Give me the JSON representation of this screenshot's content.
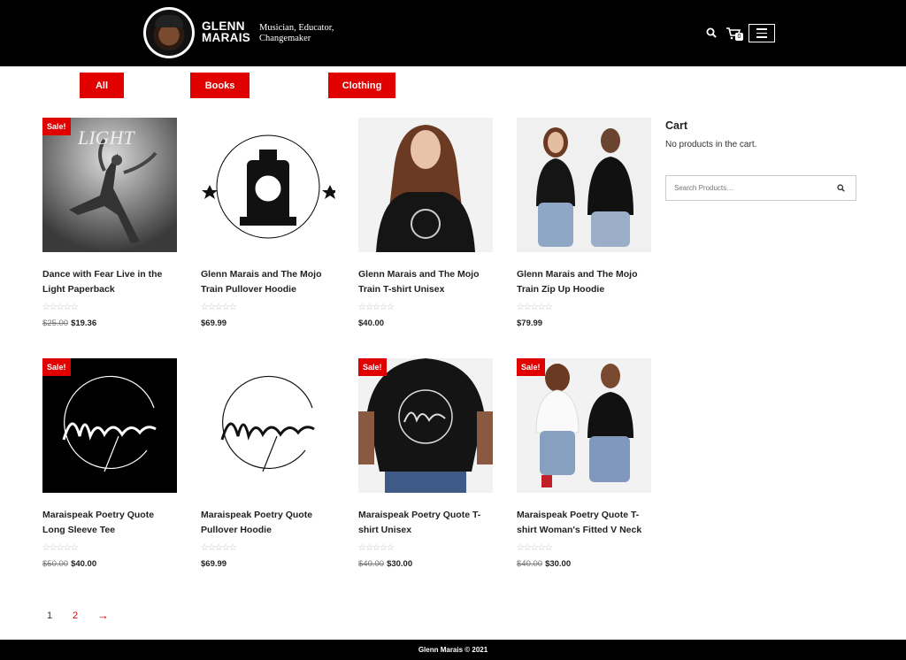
{
  "header": {
    "brand_line1": "GLENN",
    "brand_line2": "MARAIS",
    "tagline_line1": "Musician, Educator,",
    "tagline_line2": "Changemaker",
    "cart_count": "0"
  },
  "filters": [
    "All",
    "Books",
    "Clothing"
  ],
  "products": [
    {
      "title": "Dance with Fear Live in the Light Paperback",
      "sale": "Sale!",
      "old_price": "$25.00",
      "price": "$19.36",
      "image": "book-cover-dancer"
    },
    {
      "title": "Glenn Marais and The Mojo Train Pullover Hoodie",
      "sale": "",
      "old_price": "",
      "price": "$69.99",
      "image": "mojo-train-logo"
    },
    {
      "title": "Glenn Marais and The Mojo Train T-shirt Unisex",
      "sale": "",
      "old_price": "",
      "price": "$40.00",
      "image": "woman-black-tshirt"
    },
    {
      "title": "Glenn Marais and The Mojo Train Zip Up Hoodie",
      "sale": "",
      "old_price": "",
      "price": "$79.99",
      "image": "couple-black-apparel"
    },
    {
      "title": "Maraispeak Poetry Quote Long Sleeve Tee",
      "sale": "Sale!",
      "old_price": "$50.00",
      "price": "$40.00",
      "image": "maraispeak-white-on-black"
    },
    {
      "title": "Maraispeak Poetry Quote Pullover Hoodie",
      "sale": "",
      "old_price": "",
      "price": "$69.99",
      "image": "maraispeak-black-on-white"
    },
    {
      "title": "Maraispeak Poetry Quote T-shirt Unisex",
      "sale": "Sale!",
      "old_price": "$40.00",
      "price": "$30.00",
      "image": "man-back-tshirt"
    },
    {
      "title": "Maraispeak Poetry Quote T-shirt Woman's Fitted V Neck",
      "sale": "Sale!",
      "old_price": "$40.00",
      "price": "$30.00",
      "image": "couple-seated-tshirts"
    }
  ],
  "stars": "☆☆☆☆☆",
  "sidebar": {
    "cart_title": "Cart",
    "cart_empty": "No products in the cart.",
    "search_placeholder": "Search Products…"
  },
  "pagination": {
    "current": "1",
    "next_page": "2",
    "arrow": "→"
  },
  "footer": {
    "text": "Glenn Marais © 2021"
  },
  "colors": {
    "accent": "#e00000",
    "header_bg": "#000000"
  }
}
